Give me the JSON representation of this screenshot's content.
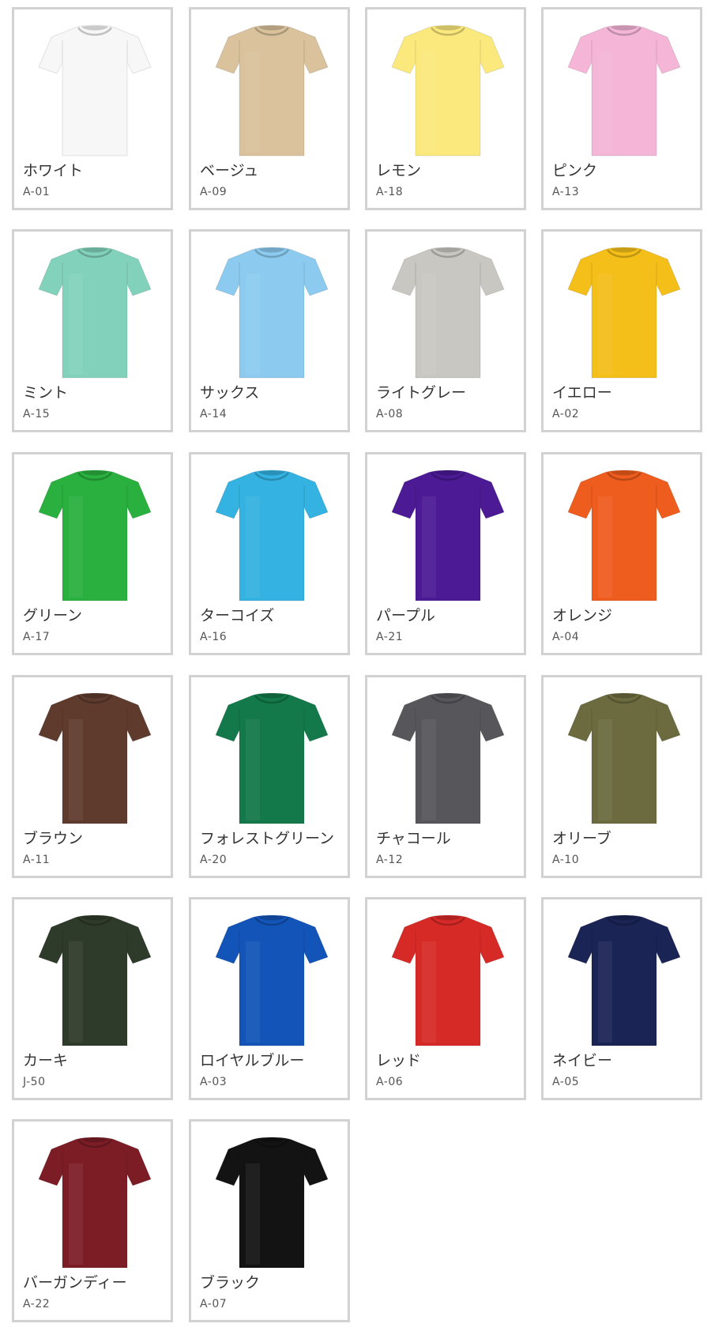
{
  "colors": [
    {
      "name": "ホワイト",
      "code": "A-01",
      "color": "#f7f7f7"
    },
    {
      "name": "ベージュ",
      "code": "A-09",
      "color": "#d9c29c"
    },
    {
      "name": "レモン",
      "code": "A-18",
      "color": "#fbe97d"
    },
    {
      "name": "ピンク",
      "code": "A-13",
      "color": "#f4b5d6"
    },
    {
      "name": "ミント",
      "code": "A-15",
      "color": "#82d2bb"
    },
    {
      "name": "サックス",
      "code": "A-14",
      "color": "#8ccbef"
    },
    {
      "name": "ライトグレー",
      "code": "A-08",
      "color": "#c9c7c1"
    },
    {
      "name": "イエロー",
      "code": "A-02",
      "color": "#f4bf19"
    },
    {
      "name": "グリーン",
      "code": "A-17",
      "color": "#2ab03f"
    },
    {
      "name": "ターコイズ",
      "code": "A-16",
      "color": "#34b2e1"
    },
    {
      "name": "パープル",
      "code": "A-21",
      "color": "#4b1a94"
    },
    {
      "name": "オレンジ",
      "code": "A-04",
      "color": "#ee5c1e"
    },
    {
      "name": "ブラウン",
      "code": "A-11",
      "color": "#5f3b2e"
    },
    {
      "name": "フォレストグリーン",
      "code": "A-20",
      "color": "#13794a"
    },
    {
      "name": "チャコール",
      "code": "A-12",
      "color": "#57575b"
    },
    {
      "name": "オリーブ",
      "code": "A-10",
      "color": "#6b6b3f"
    },
    {
      "name": "カーキ",
      "code": "J-50",
      "color": "#2e3a2a"
    },
    {
      "name": "ロイヤルブルー",
      "code": "A-03",
      "color": "#1354b8"
    },
    {
      "name": "レッド",
      "code": "A-06",
      "color": "#d62a27"
    },
    {
      "name": "ネイビー",
      "code": "A-05",
      "color": "#1a2455"
    },
    {
      "name": "バーガンディー",
      "code": "A-22",
      "color": "#7c1d26"
    },
    {
      "name": "ブラック",
      "code": "A-07",
      "color": "#131313"
    }
  ]
}
